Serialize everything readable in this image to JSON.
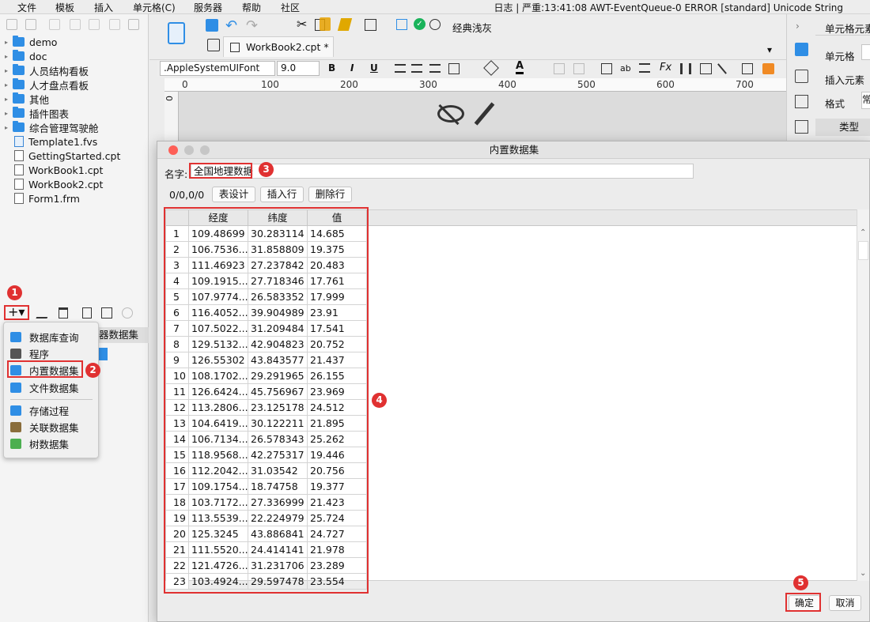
{
  "menubar": {
    "items": [
      "文件",
      "模板",
      "插入",
      "单元格(C)",
      "服务器",
      "帮助",
      "社区"
    ],
    "status": "日志 | 严重:13:41:08 AWT-EventQueue-0 ERROR [standard] Unicode String"
  },
  "filetree": [
    {
      "label": "demo",
      "type": "folder"
    },
    {
      "label": "doc",
      "type": "folder"
    },
    {
      "label": "人员结构看板",
      "type": "folder"
    },
    {
      "label": "人才盘点看板",
      "type": "folder"
    },
    {
      "label": "其他",
      "type": "folder"
    },
    {
      "label": "插件图表",
      "type": "folder"
    },
    {
      "label": "综合管理驾驶舱",
      "type": "folder"
    },
    {
      "label": "Template1.fvs",
      "type": "fvs"
    },
    {
      "label": "GettingStarted.cpt",
      "type": "file"
    },
    {
      "label": "WorkBook1.cpt",
      "type": "file"
    },
    {
      "label": "WorkBook2.cpt",
      "type": "file"
    },
    {
      "label": "Form1.frm",
      "type": "file"
    }
  ],
  "dataset_panel": {
    "plus_label": "+▾",
    "tab_partial": "器数据集"
  },
  "dataset_menu": [
    {
      "label": "数据库查询",
      "icon": "database-icon",
      "color": "#2f8ee5"
    },
    {
      "label": "程序",
      "icon": "monitor-icon",
      "color": "#555555"
    },
    {
      "label": "内置数据集",
      "icon": "builtin-dataset-icon",
      "color": "#2f8ee5"
    },
    {
      "label": "文件数据集",
      "icon": "file-dataset-icon",
      "color": "#2f8ee5"
    },
    {
      "label": "存储过程",
      "icon": "stored-procedure-icon",
      "color": "#2f8ee5"
    },
    {
      "label": "关联数据集",
      "icon": "relation-dataset-icon",
      "color": "#8a6d3b"
    },
    {
      "label": "树数据集",
      "icon": "tree-dataset-icon",
      "color": "#4caf50"
    }
  ],
  "main": {
    "theme_label": "经典浅灰",
    "tab_label": "WorkBook2.cpt *",
    "font_name": ".AppleSystemUIFont",
    "font_size": "9.0",
    "ab_label": "ab",
    "ruler_ticks": [
      "0",
      "100",
      "200",
      "300",
      "400",
      "500",
      "600",
      "700"
    ],
    "vruler_label": "0"
  },
  "right_panel": {
    "title": "单元格元素",
    "labels": [
      "单元格",
      "插入元素",
      "格式"
    ],
    "format_value": "常",
    "type_label": "类型"
  },
  "dialog": {
    "title": "内置数据集",
    "name_label": "名字:",
    "name_value": "全国地理数据",
    "counter": "0/0,0/0",
    "btn_design": "表设计",
    "btn_insert": "插入行",
    "btn_delete": "删除行",
    "ok": "确定",
    "cancel": "取消",
    "columns": [
      "经度",
      "纬度",
      "值"
    ],
    "rows": [
      [
        "1",
        "109.48699",
        "30.283114",
        "14.685"
      ],
      [
        "2",
        "106.7536...",
        "31.858809",
        "19.375"
      ],
      [
        "3",
        "111.46923",
        "27.237842",
        "20.483"
      ],
      [
        "4",
        "109.1915...",
        "27.718346",
        "17.761"
      ],
      [
        "5",
        "107.9774...",
        "26.583352",
        "17.999"
      ],
      [
        "6",
        "116.4052...",
        "39.904989",
        "23.91"
      ],
      [
        "7",
        "107.5022...",
        "31.209484",
        "17.541"
      ],
      [
        "8",
        "129.5132...",
        "42.904823",
        "20.752"
      ],
      [
        "9",
        "126.55302",
        "43.843577",
        "21.437"
      ],
      [
        "10",
        "108.1702...",
        "29.291965",
        "26.155"
      ],
      [
        "11",
        "126.6424...",
        "45.756967",
        "23.969"
      ],
      [
        "12",
        "113.2806...",
        "23.125178",
        "24.512"
      ],
      [
        "13",
        "104.6419...",
        "30.122211",
        "21.895"
      ],
      [
        "14",
        "106.7134...",
        "26.578343",
        "25.262"
      ],
      [
        "15",
        "118.9568...",
        "42.275317",
        "19.446"
      ],
      [
        "16",
        "112.2042...",
        "31.03542",
        "20.756"
      ],
      [
        "17",
        "109.1754...",
        "18.74758",
        "19.377"
      ],
      [
        "18",
        "103.7172...",
        "27.336999",
        "21.423"
      ],
      [
        "19",
        "113.5539...",
        "22.224979",
        "25.724"
      ],
      [
        "20",
        "125.3245",
        "43.886841",
        "24.727"
      ],
      [
        "21",
        "111.5520...",
        "24.414141",
        "21.978"
      ],
      [
        "22",
        "121.4726...",
        "31.231706",
        "23.289"
      ],
      [
        "23",
        "103.4924...",
        "29.597478",
        "23.554"
      ]
    ]
  },
  "badges": [
    "1",
    "2",
    "3",
    "4",
    "5"
  ],
  "colors": {
    "highlight": "#e03131",
    "accent": "#2f8ee5"
  }
}
